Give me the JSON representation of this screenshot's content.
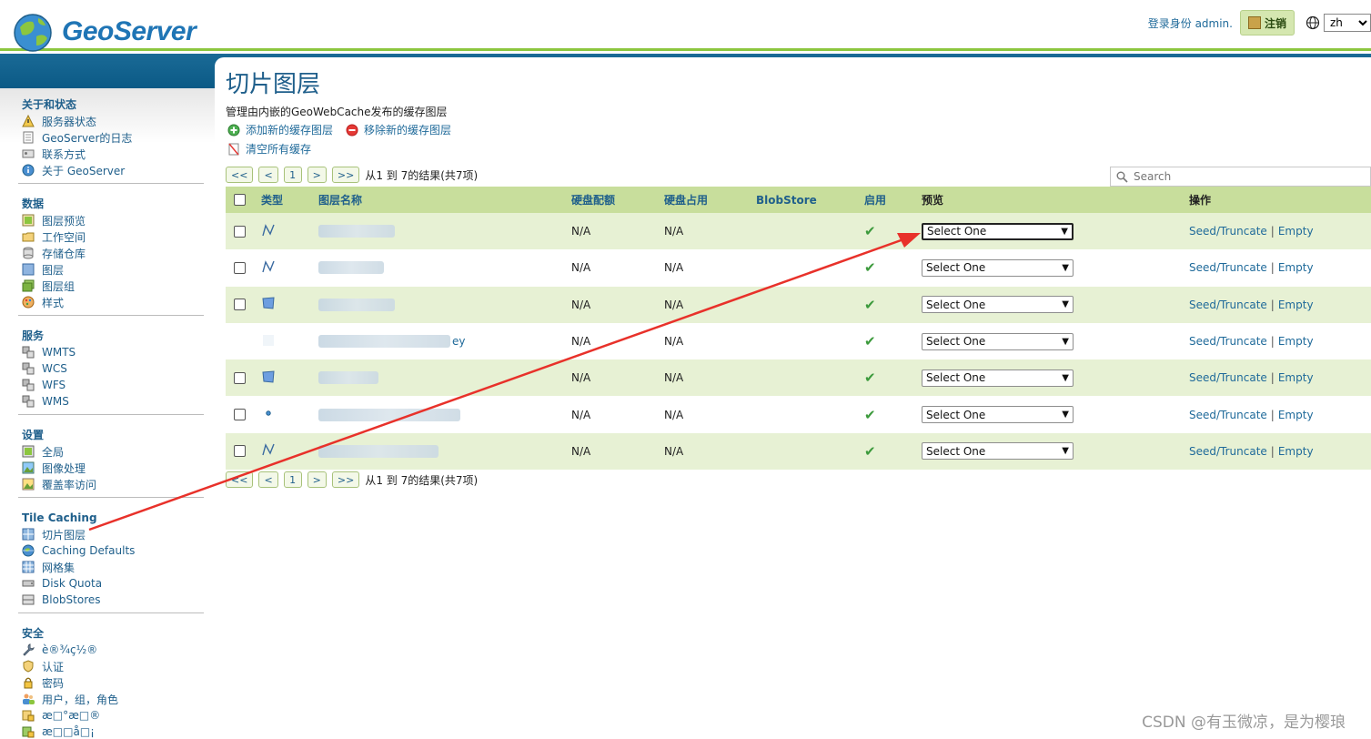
{
  "header": {
    "brand": "GeoServer",
    "login_text": "登录身份 admin.",
    "logout_label": "注销",
    "language": "zh"
  },
  "sidebar": {
    "sections": [
      {
        "title": "关于和状态",
        "items": [
          {
            "label": "服务器状态",
            "icon": "server-status-icon"
          },
          {
            "label": "GeoServer的日志",
            "icon": "log-icon"
          },
          {
            "label": "联系方式",
            "icon": "contact-icon"
          },
          {
            "label": "关于 GeoServer",
            "icon": "about-icon"
          }
        ]
      },
      {
        "title": "数据",
        "items": [
          {
            "label": "图层预览",
            "icon": "layer-preview-icon"
          },
          {
            "label": "工作空间",
            "icon": "workspace-icon"
          },
          {
            "label": "存储仓库",
            "icon": "store-icon"
          },
          {
            "label": "图层",
            "icon": "layer-icon"
          },
          {
            "label": "图层组",
            "icon": "layer-group-icon"
          },
          {
            "label": "样式",
            "icon": "style-icon"
          }
        ]
      },
      {
        "title": "服务",
        "items": [
          {
            "label": "WMTS",
            "icon": "service-icon"
          },
          {
            "label": "WCS",
            "icon": "service-icon"
          },
          {
            "label": "WFS",
            "icon": "service-icon"
          },
          {
            "label": "WMS",
            "icon": "service-icon"
          }
        ]
      },
      {
        "title": "设置",
        "items": [
          {
            "label": "全局",
            "icon": "global-icon"
          },
          {
            "label": "图像处理",
            "icon": "image-processing-icon"
          },
          {
            "label": "覆盖率访问",
            "icon": "coverage-access-icon"
          }
        ]
      },
      {
        "title": "Tile Caching",
        "items": [
          {
            "label": "切片图层",
            "icon": "tile-layers-icon"
          },
          {
            "label": "Caching Defaults",
            "icon": "caching-defaults-icon"
          },
          {
            "label": "网格集",
            "icon": "gridset-icon"
          },
          {
            "label": "Disk Quota",
            "icon": "disk-quota-icon"
          },
          {
            "label": "BlobStores",
            "icon": "blobstores-icon"
          }
        ]
      },
      {
        "title": "安全",
        "items": [
          {
            "label": "è®¾ç½®",
            "icon": "wrench-icon"
          },
          {
            "label": "认证",
            "icon": "auth-icon"
          },
          {
            "label": "密码",
            "icon": "lock-icon"
          },
          {
            "label": "用户，组，角色",
            "icon": "users-icon"
          },
          {
            "label": "æ□°æ□®",
            "icon": "data-security-icon"
          },
          {
            "label": "æ□□å□¡",
            "icon": "service-security-icon"
          }
        ]
      }
    ]
  },
  "main": {
    "title": "切片图层",
    "description": "管理由内嵌的GeoWebCache发布的缓存图层",
    "add_label": "添加新的缓存图层",
    "remove_label": "移除新的缓存图层",
    "clear_label": "清空所有缓存",
    "pager": {
      "first": "<<",
      "prev": "<",
      "page": "1",
      "next": ">",
      "last": ">>",
      "summary": "从1 到 7的结果(共7项)"
    },
    "search_placeholder": "Search",
    "columns": {
      "type": "类型",
      "name": "图层名称",
      "disk_quota": "硬盘配额",
      "disk_usage": "硬盘占用",
      "blobstore": "BlobStore",
      "enabled": "启用",
      "preview": "预览",
      "actions": "操作"
    },
    "rows": [
      {
        "type": "line",
        "name_suffix": "",
        "disk_quota": "N/A",
        "disk_usage": "N/A",
        "enabled": "✔",
        "preview": "Select One",
        "seed": "Seed/Truncate",
        "empty": "Empty",
        "sep": "|"
      },
      {
        "type": "line",
        "name_suffix": "",
        "disk_quota": "N/A",
        "disk_usage": "N/A",
        "enabled": "✔",
        "preview": "Select One",
        "seed": "Seed/Truncate",
        "empty": "Empty",
        "sep": "|"
      },
      {
        "type": "polygon",
        "name_suffix": "",
        "disk_quota": "N/A",
        "disk_usage": "N/A",
        "enabled": "✔",
        "preview": "Select One",
        "seed": "Seed/Truncate",
        "empty": "Empty",
        "sep": "|"
      },
      {
        "type": "group",
        "name_suffix": "ey",
        "disk_quota": "N/A",
        "disk_usage": "N/A",
        "enabled": "✔",
        "preview": "Select One",
        "seed": "Seed/Truncate",
        "empty": "Empty",
        "sep": "|"
      },
      {
        "type": "polygon",
        "name_suffix": "",
        "disk_quota": "N/A",
        "disk_usage": "N/A",
        "enabled": "✔",
        "preview": "Select One",
        "seed": "Seed/Truncate",
        "empty": "Empty",
        "sep": "|"
      },
      {
        "type": "point",
        "name_suffix": "",
        "disk_quota": "N/A",
        "disk_usage": "N/A",
        "enabled": "✔",
        "preview": "Select One",
        "seed": "Seed/Truncate",
        "empty": "Empty",
        "sep": "|"
      },
      {
        "type": "line",
        "name_suffix": "",
        "disk_quota": "N/A",
        "disk_usage": "N/A",
        "enabled": "✔",
        "preview": "Select One",
        "seed": "Seed/Truncate",
        "empty": "Empty",
        "sep": "|"
      }
    ]
  },
  "watermark": "CSDN @有玉微凉，是为樱琅",
  "colors": {
    "accent": "#1f5f8b",
    "header_band": "#0b5a86",
    "table_header": "#c8de9c",
    "row_odd": "#e7f1d4",
    "annotation_arrow": "#e8312a"
  }
}
